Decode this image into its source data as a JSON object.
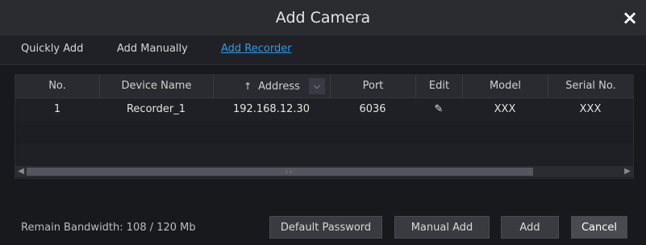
{
  "dialog": {
    "title": "Add Camera",
    "close_icon": "×"
  },
  "tabs": [
    {
      "label": "Quickly Add",
      "active": false
    },
    {
      "label": "Add Manually",
      "active": false
    },
    {
      "label": "Add Recorder",
      "active": true
    }
  ],
  "table": {
    "headers": {
      "no": "No.",
      "device_name": "Device Name",
      "address": "Address",
      "port": "Port",
      "edit": "Edit",
      "model": "Model",
      "serial": "Serial No."
    },
    "sort_icon": "↑",
    "rows": [
      {
        "no": "1",
        "device_name": "Recorder_1",
        "address": "192.168.12.30",
        "port": "6036",
        "edit_icon": "✎",
        "model": "XXX",
        "serial": "XXX"
      }
    ]
  },
  "footer": {
    "bandwidth": "Remain Bandwidth: 108 / 120 Mb",
    "buttons": {
      "default_password": "Default Password",
      "manual_add": "Manual Add",
      "add": "Add",
      "cancel": "Cancel"
    }
  },
  "colors": {
    "accent": "#2f9be6"
  }
}
